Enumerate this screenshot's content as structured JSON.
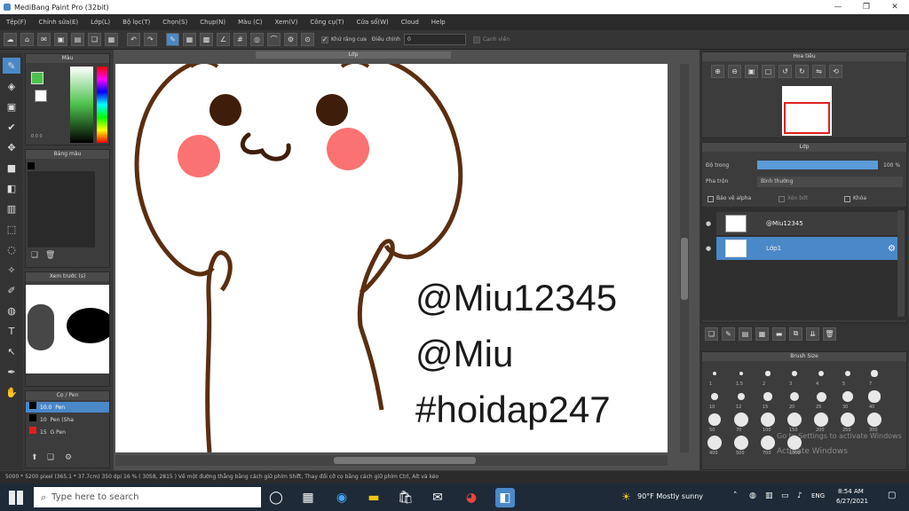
{
  "window": {
    "title": "MediBang Paint Pro (32bit)"
  },
  "menu": [
    "Tệp(F)",
    "Chỉnh sửa(E)",
    "Lớp(L)",
    "Bộ lọc(T)",
    "Chọn(S)",
    "Chụp(N)",
    "Màu (C)",
    "Xem(V)",
    "Công cụ(T)",
    "Cửa sổ(W)",
    "Cloud",
    "Help"
  ],
  "toolbar": {
    "option1": "Khử răng cưa",
    "option2": "Điều chỉnh",
    "option2_value": "0",
    "option3": "Cạnh viền"
  },
  "panels": {
    "color_title": "Màu",
    "color_hex_main": "0 0 0",
    "palette_title": "Bảng màu",
    "navigator_title": "Xem trước (s)",
    "brush_list_title": "Cọ / Pen",
    "brushes": [
      {
        "size": "10.0",
        "name": "Pen"
      },
      {
        "size": "10",
        "name": "Pen (Sha"
      },
      {
        "size": "15",
        "name": "G Pen"
      }
    ]
  },
  "canvas": {
    "tab": "Lớp",
    "watermark_lines": [
      "@Miu12345",
      "@Miu",
      "#hoidap247"
    ]
  },
  "right": {
    "navigator_title": "Hoa tiêu",
    "layer_panel_title": "Lớp",
    "opacity_label": "Độ trong",
    "opacity_value": "100 %",
    "opacity_fraction": 1.0,
    "blend_label": "Pha trộn",
    "blend_value": "Bình thường",
    "protect_alpha": "Bảo vệ alpha",
    "clipping": "Xén bớt",
    "lock": "Khóa",
    "layers": [
      {
        "name": "@Miu12345",
        "selected": false
      },
      {
        "name": "Lớp1",
        "selected": true
      }
    ],
    "brush_size_title": "Brush Size",
    "brush_sizes": [
      "1",
      "1.5",
      "2",
      "3",
      "4",
      "5",
      "7",
      "10",
      "12",
      "15",
      "20",
      "25",
      "30",
      "40",
      "50",
      "70",
      "100",
      "150",
      "200",
      "250",
      "300",
      "400",
      "500",
      "700",
      "1000"
    ],
    "activate_line1": "Go to Settings to activate Windows",
    "activate_line2": "Activate Windows"
  },
  "status": {
    "text": "5000 * 5200 pixel  (365.1 * 37.7cm)  350 dpi  16 %  ( 3058, 2815 )  Vẽ một đường thẳng bằng cách giữ phím Shift, Thay đổi cỡ cọ bằng cách giữ phím Ctrl, Alt và kéo"
  },
  "taskbar": {
    "search_placeholder": "Type here to search",
    "weather": "90°F  Mostly sunny",
    "lang": "ENG",
    "time": "8:54 AM",
    "date": "6/27/2021"
  },
  "colors": {
    "accent": "#4a88c7",
    "line": "#5b2e10",
    "eyes": "#3e1e0a",
    "blush": "#fb7272"
  }
}
